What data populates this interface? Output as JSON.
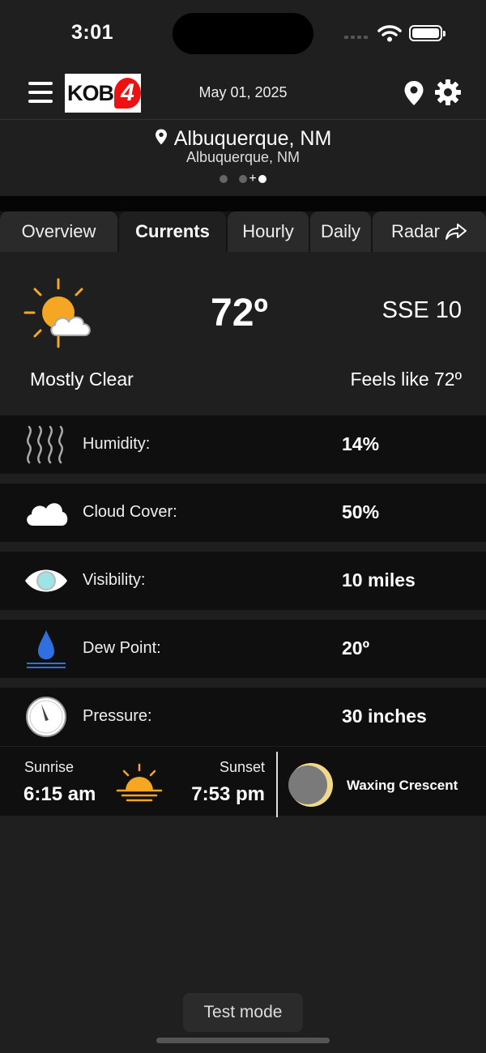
{
  "status_bar": {
    "time": "3:01"
  },
  "header": {
    "logo_text": "KOB",
    "logo_number": "4",
    "date": "May 01, 2025"
  },
  "location": {
    "name": "Albuquerque, NM",
    "subtitle": "Albuquerque, NM",
    "page_dots": 3,
    "active_dot": 3
  },
  "tabs": [
    {
      "label": "Overview",
      "active": false
    },
    {
      "label": "Currents",
      "active": true
    },
    {
      "label": "Hourly",
      "active": false
    },
    {
      "label": "Daily",
      "active": false
    },
    {
      "label": "Radar",
      "active": false
    }
  ],
  "current": {
    "icon": "partly-cloudy-icon",
    "temperature": "72º",
    "wind": "SSE 10",
    "condition": "Mostly Clear",
    "feels_like": "Feels like 72º"
  },
  "details": [
    {
      "icon": "humidity-icon",
      "label": "Humidity:",
      "value": "14%"
    },
    {
      "icon": "cloud-icon",
      "label": "Cloud Cover:",
      "value": "50%"
    },
    {
      "icon": "eye-icon",
      "label": "Visibility:",
      "value": "10 miles"
    },
    {
      "icon": "water-drop-icon",
      "label": "Dew Point:",
      "value": "20º"
    },
    {
      "icon": "gauge-icon",
      "label": "Pressure:",
      "value": "30 inches"
    }
  ],
  "sun": {
    "sunrise_label": "Sunrise",
    "sunrise_time": "6:15 am",
    "sunset_label": "Sunset",
    "sunset_time": "7:53 pm"
  },
  "moon": {
    "phase": "Waxing Crescent"
  },
  "footer": {
    "test_mode": "Test mode"
  },
  "colors": {
    "background": "#1f1f1f",
    "row_background": "#0f0f0f",
    "sun_orange": "#f5a623",
    "drop_blue": "#2f6fe0",
    "moon_yellow": "#f0d98a"
  }
}
